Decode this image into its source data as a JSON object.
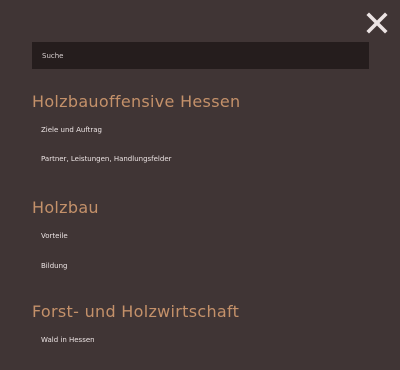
{
  "search": {
    "placeholder": "Suche"
  },
  "close_icon": "close-icon",
  "accent_color": "#c4916a",
  "sections": [
    {
      "title": "Holzbauoffensive Hessen",
      "links": [
        "Ziele und Auftrag",
        "Partner, Leistungen, Handlungsfelder"
      ]
    },
    {
      "title": "Holzbau",
      "links": [
        "Vorteile",
        "Bildung"
      ]
    },
    {
      "title": "Forst- und Holzwirtschaft",
      "links": [
        "Wald in Hessen"
      ]
    }
  ]
}
